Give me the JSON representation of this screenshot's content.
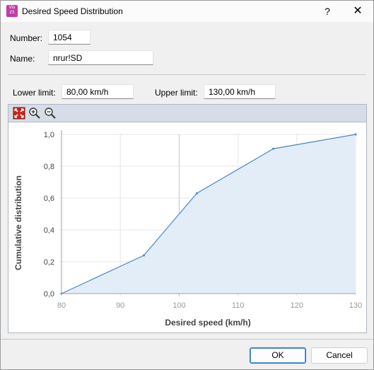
{
  "window": {
    "title": "Desired Speed Distribution",
    "icon_text_top": "Vis",
    "icon_text_bottom": "25",
    "help_icon": "question-mark",
    "close_icon": "close-x"
  },
  "form": {
    "number_label": "Number:",
    "number_value": "1054",
    "name_label": "Name:",
    "name_value": "nrur!SD",
    "lower_limit_label": "Lower limit:",
    "lower_limit_value": "80,00 km/h",
    "upper_limit_label": "Upper limit:",
    "upper_limit_value": "130,00 km/h"
  },
  "toolbar": {
    "icons": [
      "zoom-fit-icon",
      "zoom-in-icon",
      "zoom-out-icon"
    ]
  },
  "chart_data": {
    "type": "area",
    "xlabel": "Desired speed (km/h)",
    "ylabel": "Cumulative distribution",
    "x_ticks": [
      "80",
      "90",
      "100",
      "110",
      "120",
      "130"
    ],
    "y_ticks": [
      "0,0",
      "0,2",
      "0,4",
      "0,6",
      "0,8",
      "1,0"
    ],
    "xlim": [
      80,
      130
    ],
    "ylim": [
      0,
      1
    ],
    "grid": true,
    "points": [
      {
        "x": 80,
        "y": 0.0
      },
      {
        "x": 94,
        "y": 0.24
      },
      {
        "x": 103,
        "y": 0.63
      },
      {
        "x": 116,
        "y": 0.91
      },
      {
        "x": 130,
        "y": 1.0
      }
    ],
    "line_color": "#4a86c8",
    "fill_color": "#e3edf8"
  },
  "buttons": {
    "ok_label": "OK",
    "cancel_label": "Cancel"
  }
}
